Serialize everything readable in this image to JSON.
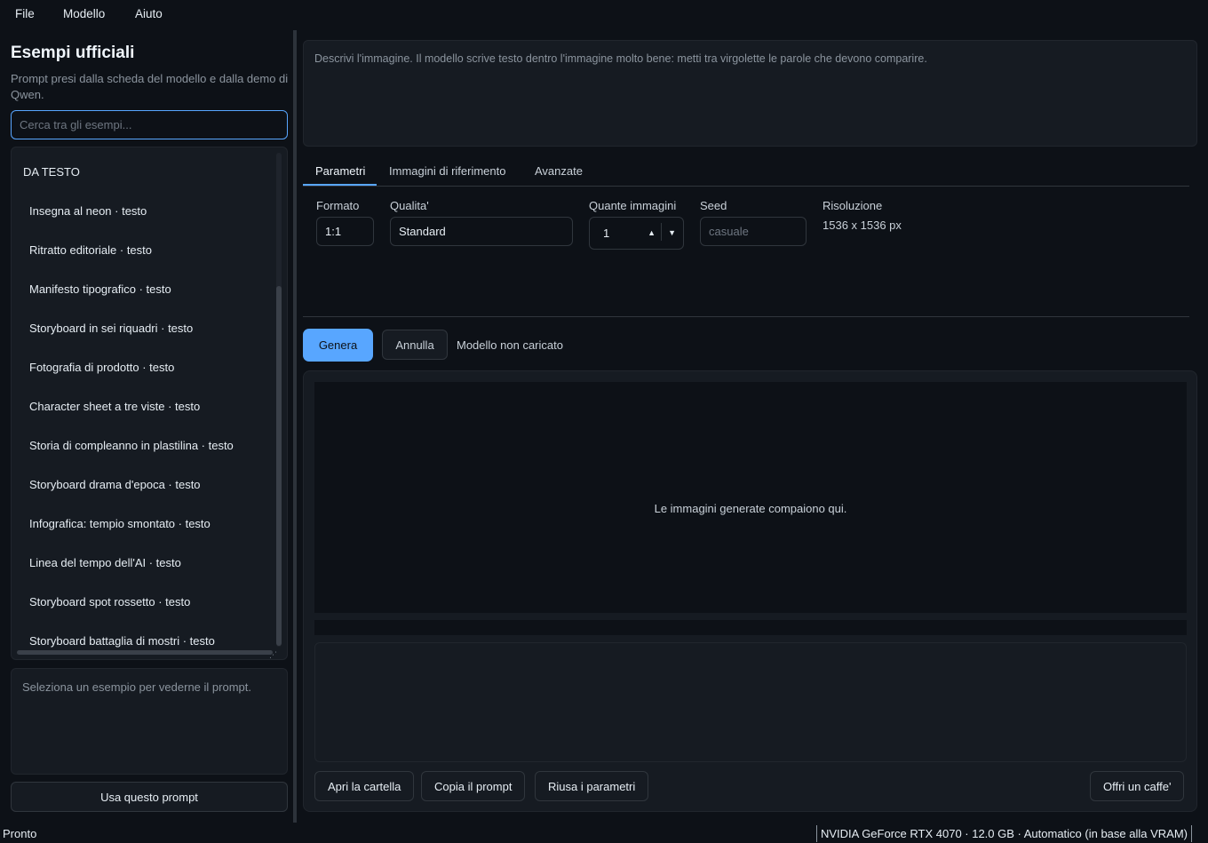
{
  "menu": [
    "File",
    "Modello",
    "Aiuto"
  ],
  "sidebar": {
    "title": "Esempi ufficiali",
    "subtitle": "Prompt presi dalla scheda del modello e dalla demo di Qwen.",
    "search_placeholder": "Cerca tra gli esempi...",
    "section": "DA TESTO",
    "items": [
      "Insegna al neon  ·  testo",
      "Ritratto editoriale  ·  testo",
      "Manifesto tipografico  ·  testo",
      "Storyboard in sei riquadri  ·  testo",
      "Fotografia di prodotto  ·  testo",
      "Character sheet a tre viste  ·  testo",
      "Storia di compleanno in plastilina  ·  testo",
      "Storyboard drama d'epoca  ·  testo",
      "Infografica: tempio smontato  ·  testo",
      "Linea del tempo dell'AI  ·  testo",
      "Storyboard spot rossetto  ·  testo",
      "Storyboard battaglia di mostri  ·  testo"
    ],
    "preview_placeholder": "Seleziona un esempio per vederne il prompt.",
    "use_button": "Usa questo prompt"
  },
  "prompt": {
    "placeholder": "Descrivi l'immagine. Il modello scrive testo dentro l'immagine molto bene: metti tra virgolette le parole che devono comparire."
  },
  "tabs": [
    "Parametri",
    "Immagini di riferimento",
    "Avanzate"
  ],
  "params": {
    "format_label": "Formato",
    "format_value": "1:1",
    "quality_label": "Qualita'",
    "quality_value": "Standard",
    "count_label": "Quante immagini",
    "count_value": "1",
    "seed_label": "Seed",
    "seed_placeholder": "casuale",
    "resolution_label": "Risoluzione",
    "resolution_value": "1536 x 1536 px"
  },
  "actions": {
    "generate": "Genera",
    "cancel": "Annulla",
    "model_status": "Modello non caricato"
  },
  "output": {
    "empty_message": "Le immagini generate compaiono qui.",
    "open_folder": "Apri la cartella",
    "copy_prompt": "Copia il prompt",
    "reuse_params": "Riusa i parametri",
    "coffee": "Offri un caffe'"
  },
  "statusbar": {
    "left": "Pronto",
    "right": "NVIDIA GeForce RTX 4070 · 12.0 GB · Automatico (in base alla VRAM)"
  },
  "colors": {
    "background": "#0d1117",
    "panel": "#161b22",
    "accent": "#58a6ff"
  }
}
